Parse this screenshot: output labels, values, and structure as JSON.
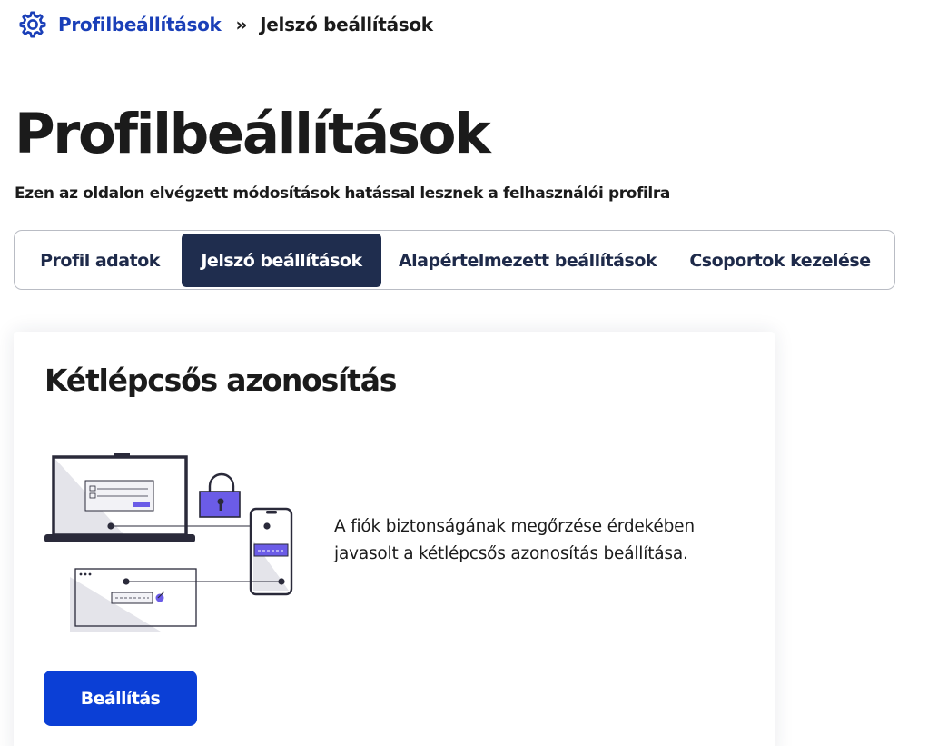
{
  "breadcrumb": {
    "icon": "gear-icon",
    "parent": "Profilbeállítások",
    "separator": "»",
    "current": "Jelszó beállítások"
  },
  "page": {
    "title": "Profilbeállítások",
    "subtitle": "Ezen az oldalon elvégzett módosítások hatással lesznek a felhasználói profilra"
  },
  "tabs": [
    {
      "label": "Profil adatok",
      "active": false
    },
    {
      "label": "Jelszó beállítások",
      "active": true
    },
    {
      "label": "Alapértelmezett beállítások",
      "active": false
    },
    {
      "label": "Csoportok kezelése",
      "active": false
    }
  ],
  "card": {
    "title": "Kétlépcsős azonosítás",
    "description": "A fiók biztonságának megőrzése érdekében javasolt a kétlépcsős azonosítás beállítása.",
    "button_label": "Beállítás",
    "illustration": "two-factor-devices-illustration"
  },
  "colors": {
    "link": "#1a3fb8",
    "active_tab": "#1f2d4e",
    "primary_button": "#0b3fd6",
    "accent_purple": "#6b5ce7"
  }
}
